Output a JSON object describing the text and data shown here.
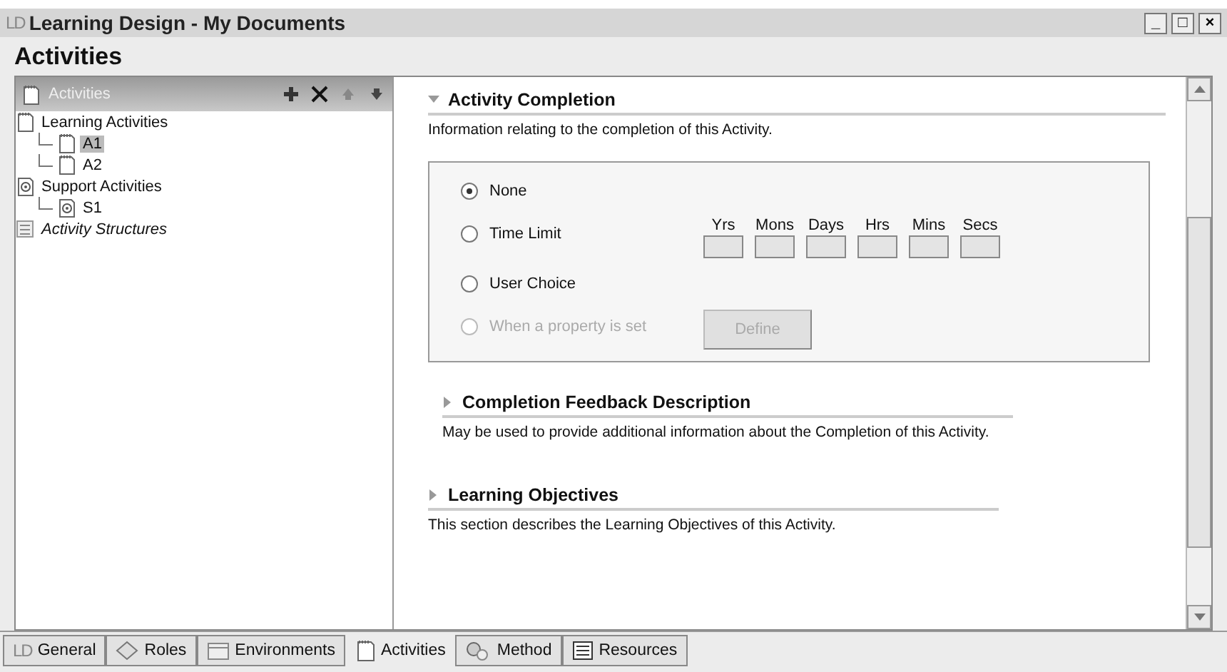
{
  "window": {
    "logo": "LD",
    "title": "Learning Design - My Documents",
    "controls": [
      "_",
      "□",
      "×"
    ]
  },
  "heading": "Activities",
  "tree": {
    "header": "Activities",
    "items": [
      {
        "label": "Learning Activities",
        "kind": "activity",
        "selected": false,
        "children": [
          {
            "label": "A1",
            "kind": "activity",
            "selected": true
          },
          {
            "label": "A2",
            "kind": "activity",
            "selected": false
          }
        ]
      },
      {
        "label": "Support Activities",
        "kind": "support",
        "selected": false,
        "children": [
          {
            "label": "S1",
            "kind": "support",
            "selected": false
          }
        ]
      },
      {
        "label": "Activity Structures",
        "kind": "structure",
        "selected": false
      }
    ]
  },
  "sections": [
    {
      "title": "Activity Completion",
      "expanded": true,
      "description": "Information relating to the completion of this Activity.",
      "options": [
        {
          "label": "None",
          "selected": true,
          "disabled": false
        },
        {
          "label": "Time Limit",
          "selected": false,
          "disabled": false
        },
        {
          "label": "User Choice",
          "selected": false,
          "disabled": false
        },
        {
          "label": "When a property is set",
          "selected": false,
          "disabled": true
        }
      ],
      "time_fields": [
        "Yrs",
        "Mons",
        "Days",
        "Hrs",
        "Mins",
        "Secs"
      ],
      "define_button": {
        "label": "Define",
        "disabled": true
      }
    },
    {
      "title": "Completion Feedback Description",
      "expanded": false,
      "description": "May be used to provide additional information about the Completion of this Activity."
    },
    {
      "title": "Learning Objectives",
      "expanded": false,
      "description": "This section describes the Learning Objectives of this Activity."
    }
  ],
  "bottom_tabs": [
    {
      "label": "General",
      "kind": "logo",
      "icon_text": "LD",
      "selected": false
    },
    {
      "label": "Roles",
      "kind": "roles",
      "selected": false
    },
    {
      "label": "Environments",
      "kind": "environments",
      "selected": false
    },
    {
      "label": "Activities",
      "kind": "activities",
      "selected": true
    },
    {
      "label": "Method",
      "kind": "method",
      "selected": false
    },
    {
      "label": "Resources",
      "kind": "resources",
      "selected": false
    }
  ]
}
